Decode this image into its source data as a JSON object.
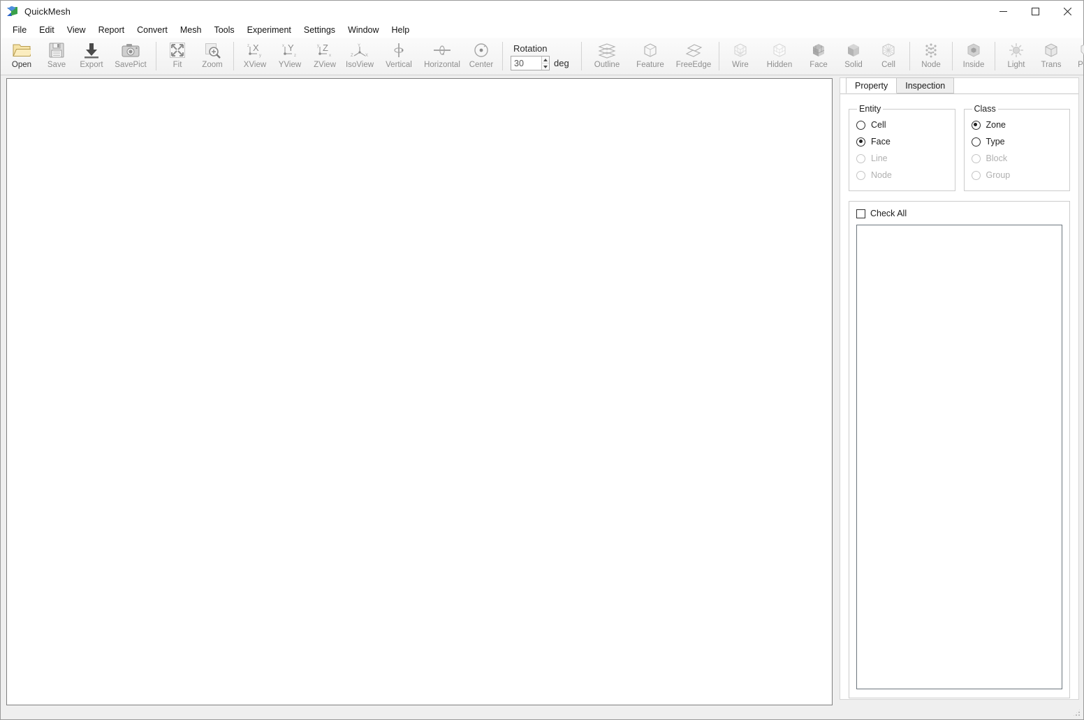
{
  "window": {
    "title": "QuickMesh",
    "icon": "app-cube-icon",
    "controls": {
      "minimize": "—",
      "maximize": "□",
      "close": "✕"
    }
  },
  "menubar": {
    "items": [
      {
        "label": "File"
      },
      {
        "label": "Edit"
      },
      {
        "label": "View"
      },
      {
        "label": "Report"
      },
      {
        "label": "Convert"
      },
      {
        "label": "Mesh"
      },
      {
        "label": "Tools"
      },
      {
        "label": "Experiment"
      },
      {
        "label": "Settings"
      },
      {
        "label": "Window"
      },
      {
        "label": "Help"
      }
    ]
  },
  "toolbar": {
    "groups": [
      {
        "name": "file",
        "buttons": [
          {
            "label": "Open",
            "icon": "folder-open-icon",
            "enabled": true
          },
          {
            "label": "Save",
            "icon": "floppy-disk-icon",
            "enabled": false
          },
          {
            "label": "Export",
            "icon": "download-arrow-icon",
            "enabled": false
          },
          {
            "label": "SavePict",
            "icon": "camera-icon",
            "enabled": false
          }
        ]
      },
      {
        "name": "zoom",
        "buttons": [
          {
            "label": "Fit",
            "icon": "fit-arrows-icon",
            "enabled": false
          },
          {
            "label": "Zoom",
            "icon": "magnifier-plus-icon",
            "enabled": false
          }
        ]
      },
      {
        "name": "views",
        "buttons": [
          {
            "label": "XView",
            "icon": "axis-x-icon",
            "enabled": false
          },
          {
            "label": "YView",
            "icon": "axis-y-icon",
            "enabled": false
          },
          {
            "label": "ZView",
            "icon": "axis-z-icon",
            "enabled": false
          },
          {
            "label": "IsoView",
            "icon": "axis-iso-icon",
            "enabled": false
          },
          {
            "label": "Vertical",
            "icon": "rotate-vertical-icon",
            "enabled": false
          },
          {
            "label": "Horizontal",
            "icon": "rotate-horizontal-icon",
            "enabled": false
          },
          {
            "label": "Center",
            "icon": "center-target-icon",
            "enabled": false
          }
        ]
      },
      {
        "name": "display",
        "buttons": [
          {
            "label": "Outline",
            "icon": "layers-outline-icon",
            "enabled": false
          },
          {
            "label": "Feature",
            "icon": "cube-feature-icon",
            "enabled": false
          },
          {
            "label": "FreeEdge",
            "icon": "free-edge-icon",
            "enabled": false
          }
        ]
      },
      {
        "name": "render",
        "buttons": [
          {
            "label": "Wire",
            "icon": "cube-wire-icon",
            "enabled": false
          },
          {
            "label": "Hidden",
            "icon": "cube-hidden-icon",
            "enabled": false
          },
          {
            "label": "Face",
            "icon": "cube-face-icon",
            "enabled": false
          },
          {
            "label": "Solid",
            "icon": "cube-solid-icon",
            "enabled": false
          },
          {
            "label": "Cell",
            "icon": "cube-cell-icon",
            "enabled": false
          }
        ]
      },
      {
        "name": "node",
        "buttons": [
          {
            "label": "Node",
            "icon": "node-points-icon",
            "enabled": false
          }
        ]
      },
      {
        "name": "inside",
        "buttons": [
          {
            "label": "Inside",
            "icon": "inside-cube-icon",
            "enabled": false
          }
        ]
      },
      {
        "name": "appearance",
        "buttons": [
          {
            "label": "Light",
            "icon": "sun-light-icon",
            "enabled": false
          },
          {
            "label": "Trans",
            "icon": "cube-transparent-icon",
            "enabled": false
          },
          {
            "label": "Pers",
            "icon": "perspective-icon",
            "enabled": false
          }
        ]
      }
    ],
    "rotation": {
      "label": "Rotation",
      "value": "30",
      "unit": "deg",
      "spin_up": "increment",
      "spin_down": "decrement"
    }
  },
  "right_panel": {
    "tabs": [
      {
        "label": "Property",
        "active": true
      },
      {
        "label": "Inspection",
        "active": false
      }
    ],
    "entity": {
      "legend": "Entity",
      "options": [
        {
          "label": "Cell",
          "selected": false,
          "enabled": true
        },
        {
          "label": "Face",
          "selected": true,
          "enabled": true
        },
        {
          "label": "Line",
          "selected": false,
          "enabled": false
        },
        {
          "label": "Node",
          "selected": false,
          "enabled": false
        }
      ]
    },
    "class": {
      "legend": "Class",
      "options": [
        {
          "label": "Zone",
          "selected": true,
          "enabled": true
        },
        {
          "label": "Type",
          "selected": false,
          "enabled": true
        },
        {
          "label": "Block",
          "selected": false,
          "enabled": false
        },
        {
          "label": "Group",
          "selected": false,
          "enabled": false
        }
      ]
    },
    "check_all": {
      "label": "Check All",
      "checked": false
    },
    "list_items": []
  },
  "viewport": {
    "name": "3d-mesh-viewport",
    "content": ""
  },
  "colors": {
    "toolbar_bg": "#f4f4f4",
    "panel_bg": "#ffffff",
    "viewport_bg": "#ffffff",
    "accent": "#2a63c8",
    "disabled_text": "#b0b0b0",
    "border": "#cccccc"
  }
}
